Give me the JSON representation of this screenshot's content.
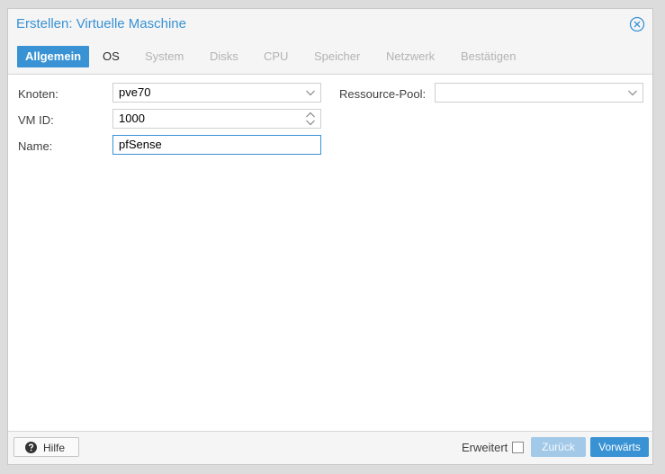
{
  "window": {
    "title": "Erstellen: Virtuelle Maschine",
    "close_icon": "close-circle-icon"
  },
  "tabs": [
    {
      "label": "Allgemein",
      "state": "active"
    },
    {
      "label": "OS",
      "state": "enabled"
    },
    {
      "label": "System",
      "state": "disabled"
    },
    {
      "label": "Disks",
      "state": "disabled"
    },
    {
      "label": "CPU",
      "state": "disabled"
    },
    {
      "label": "Speicher",
      "state": "disabled"
    },
    {
      "label": "Netzwerk",
      "state": "disabled"
    },
    {
      "label": "Bestätigen",
      "state": "disabled"
    }
  ],
  "form": {
    "node_label": "Knoten:",
    "node_value": "pve70",
    "vmid_label": "VM ID:",
    "vmid_value": "1000",
    "name_label": "Name:",
    "name_value": "pfSense",
    "pool_label": "Ressource-Pool:",
    "pool_value": ""
  },
  "footer": {
    "help_label": "Hilfe",
    "advanced_label": "Erweitert",
    "advanced_checked": false,
    "back_label": "Zurück",
    "next_label": "Vorwärts"
  },
  "colors": {
    "accent": "#3892d4",
    "disabled_button": "#a2c9e8",
    "header_bg": "#f5f5f5"
  }
}
